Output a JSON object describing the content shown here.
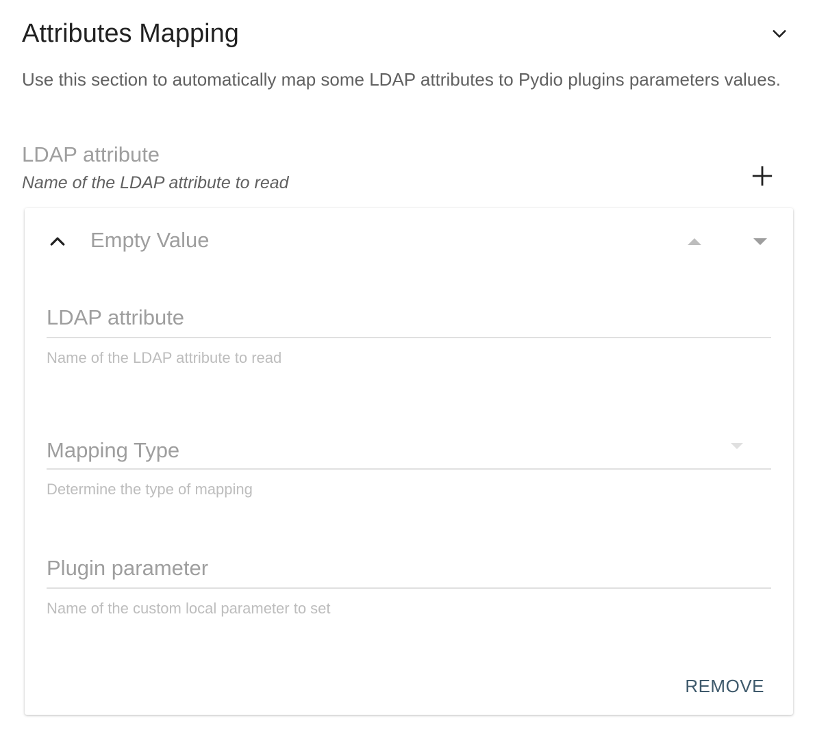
{
  "section": {
    "title": "Attributes Mapping",
    "description": "Use this section to automatically map some LDAP attributes to Pydio plugins parameters values."
  },
  "group": {
    "label": "LDAP attribute",
    "hint": "Name of the LDAP attribute to read"
  },
  "card": {
    "title": "Empty Value",
    "fields": {
      "ldap_attribute": {
        "placeholder": "LDAP attribute",
        "value": "",
        "hint": "Name of the LDAP attribute to read"
      },
      "mapping_type": {
        "placeholder": "Mapping Type",
        "hint": "Determine the type of mapping"
      },
      "plugin_parameter": {
        "placeholder": "Plugin parameter",
        "value": "",
        "hint": "Name of the custom local parameter to set"
      }
    },
    "remove_label": "REMOVE"
  },
  "icons": {
    "collapse": "chevron-down-icon",
    "add": "plus-icon",
    "expand": "chevron-up-icon",
    "move_up": "caret-up-icon",
    "move_down": "caret-down-icon",
    "select_arrow": "caret-down-icon"
  },
  "colors": {
    "primary_text": "#212121",
    "secondary_text": "#616161",
    "placeholder": "#9e9e9e",
    "hint": "#bdbdbd",
    "accent": "#3f5a6c"
  }
}
